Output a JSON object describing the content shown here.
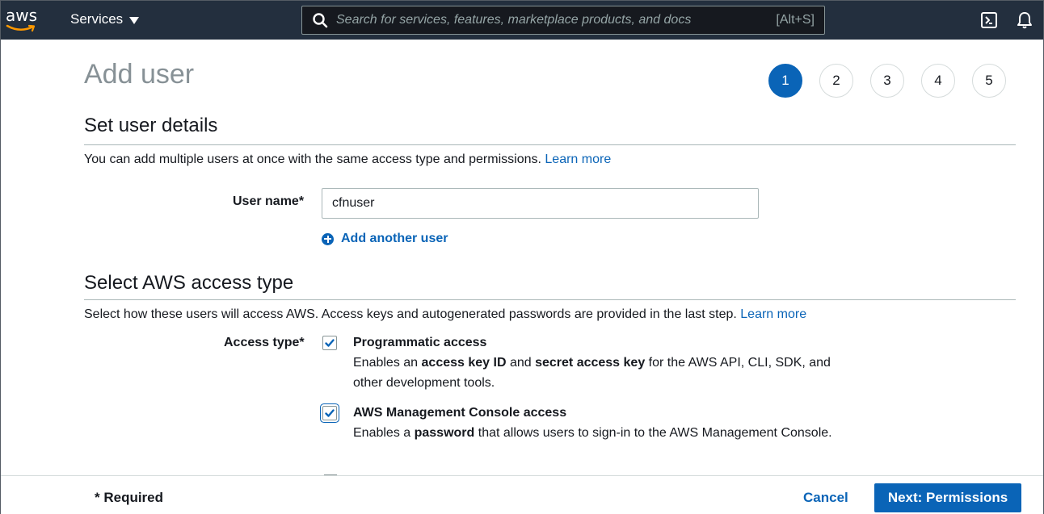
{
  "nav": {
    "logo_text": "aws",
    "services_label": "Services",
    "search_placeholder": "Search for services, features, marketplace products, and docs",
    "search_shortcut": "[Alt+S]",
    "icons": [
      "cloudshell-icon",
      "bell-icon"
    ]
  },
  "page": {
    "title": "Add user",
    "steps": [
      "1",
      "2",
      "3",
      "4",
      "5"
    ],
    "active_step": "1"
  },
  "user_details": {
    "heading": "Set user details",
    "description": "You can add multiple users at once with the same access type and permissions.",
    "learn_more": "Learn more",
    "username_label": "User name*",
    "username_value": "cfnuser",
    "add_another": "Add another user"
  },
  "access_type": {
    "heading": "Select AWS access type",
    "description": "Select how these users will access AWS. Access keys and autogenerated passwords are provided in the last step.",
    "learn_more": "Learn more",
    "label": "Access type*",
    "options": [
      {
        "title": "Programmatic access",
        "checked": true,
        "desc_parts": [
          "Enables an ",
          "access key ID",
          " and ",
          "secret access key",
          " for the AWS API, CLI, SDK, and other development tools."
        ]
      },
      {
        "title": "AWS Management Console access",
        "checked": true,
        "desc_parts": [
          "Enables a ",
          "password",
          " that allows users to sign-in to the AWS Management Console."
        ]
      }
    ]
  },
  "footer": {
    "required": "* Required",
    "cancel": "Cancel",
    "next": "Next: Permissions"
  },
  "colors": {
    "nav_bg": "#232f3e",
    "accent": "#0a64b7",
    "title_gray": "#879196"
  }
}
